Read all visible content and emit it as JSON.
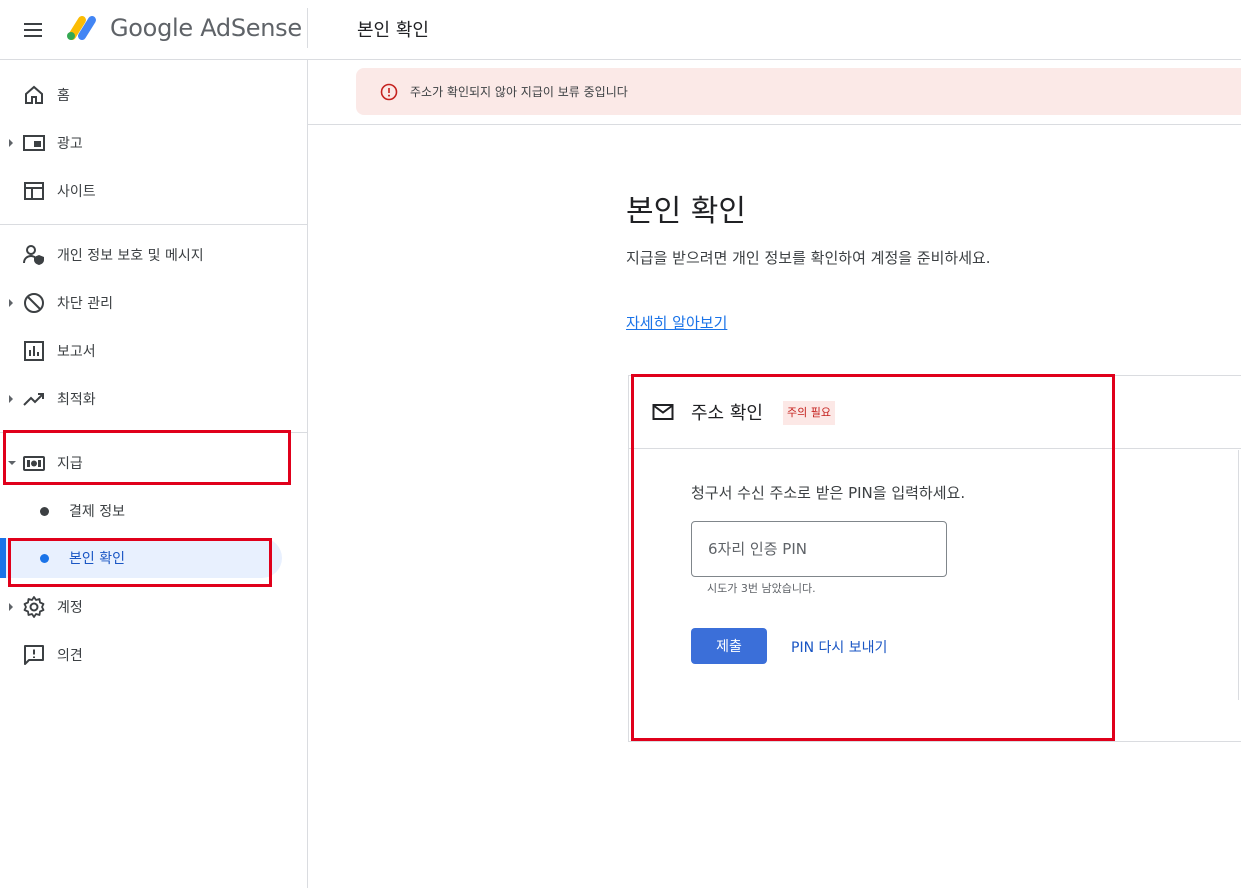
{
  "header": {
    "brand_google": "Google",
    "brand_product": "AdSense",
    "title": "본인 확인"
  },
  "sidebar": {
    "items": [
      {
        "label": "홈",
        "icon": "home-icon"
      },
      {
        "label": "광고",
        "icon": "ads-icon"
      },
      {
        "label": "사이트",
        "icon": "sites-icon"
      },
      {
        "label": "개인 정보 보호 및 메시지",
        "icon": "privacy-icon"
      },
      {
        "label": "차단 관리",
        "icon": "block-icon"
      },
      {
        "label": "보고서",
        "icon": "reports-icon"
      },
      {
        "label": "최적화",
        "icon": "optimization-icon"
      },
      {
        "label": "지급",
        "icon": "payments-icon"
      },
      {
        "label": "결제 정보"
      },
      {
        "label": "본인 확인"
      },
      {
        "label": "계정",
        "icon": "gear-icon"
      },
      {
        "label": "의견",
        "icon": "feedback-icon"
      }
    ]
  },
  "alert": {
    "text": "주소가 확인되지 않아 지급이 보류 중입니다"
  },
  "main": {
    "title": "본인 확인",
    "description": "지급을 받으려면 개인 정보를 확인하여 계정을 준비하세요.",
    "learn_more": "자세히 알아보기"
  },
  "card": {
    "title": "주소 확인",
    "badge": "주의 필요",
    "instruction": "청구서 수신 주소로 받은 PIN을 입력하세요.",
    "pin_placeholder": "6자리 인증 PIN",
    "helper": "시도가 3번 남았습니다.",
    "submit_label": "제출",
    "resend_label": "PIN 다시 보내기"
  },
  "colors": {
    "accent": "#1a73e8",
    "highlight": "#e0001b",
    "alert_bg": "#fbe9e7"
  }
}
